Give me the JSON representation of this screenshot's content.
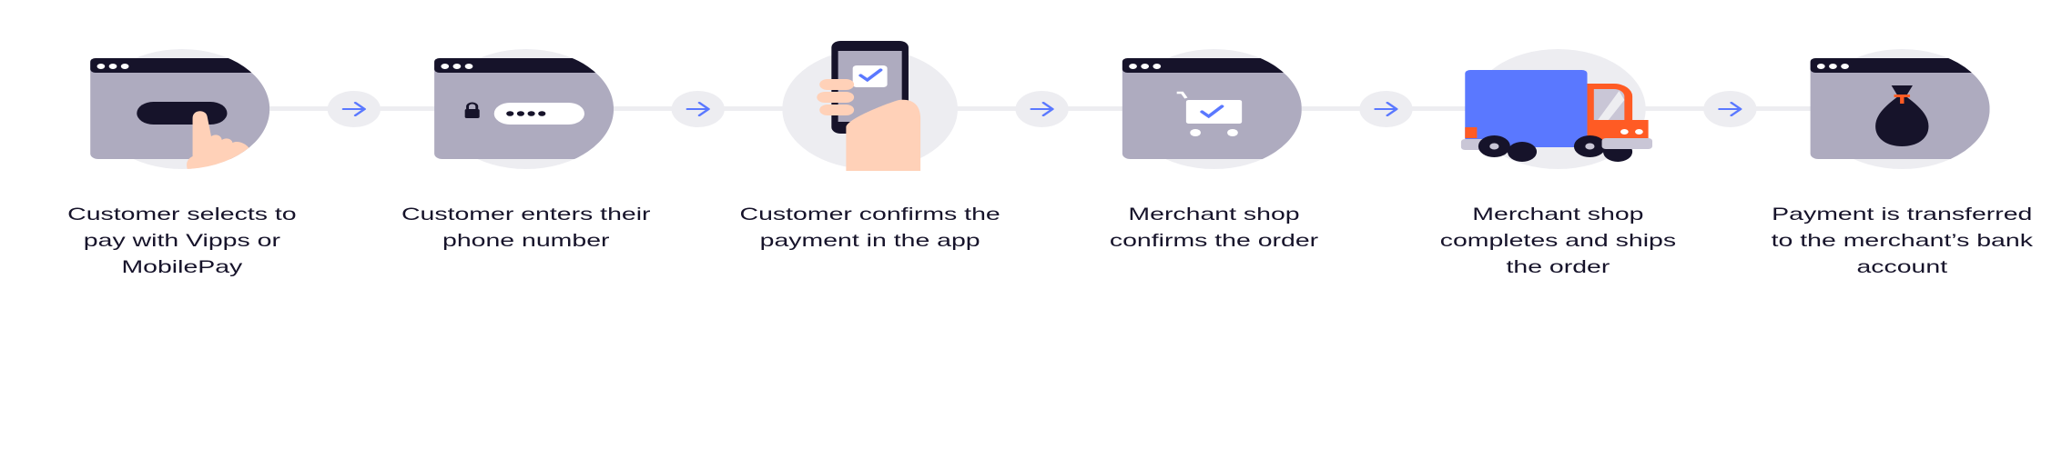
{
  "colors": {
    "dark": "#16132a",
    "window": "#aeabbf",
    "light": "#ededf1",
    "accent": "#5a78ff",
    "orange": "#ff5b24",
    "skin": "#ffd1b8"
  },
  "steps": [
    {
      "icon": "browser-tap-button-icon",
      "lines": [
        "Customer selects to",
        "pay with Vipps or",
        "MobilePay"
      ]
    },
    {
      "icon": "browser-password-icon",
      "lines": [
        "Customer enters their",
        "phone number"
      ]
    },
    {
      "icon": "phone-confirm-icon",
      "lines": [
        "Customer confirms the",
        "payment in the app"
      ]
    },
    {
      "icon": "browser-cart-check-icon",
      "lines": [
        "Merchant shop",
        "confirms the order"
      ]
    },
    {
      "icon": "delivery-truck-icon",
      "lines": [
        "Merchant shop",
        "completes and ships",
        "the order"
      ]
    },
    {
      "icon": "browser-money-bag-icon",
      "lines": [
        "Payment is transferred",
        "to the merchant’s bank",
        "account"
      ]
    }
  ],
  "connector_icon": "arrow-right-icon"
}
